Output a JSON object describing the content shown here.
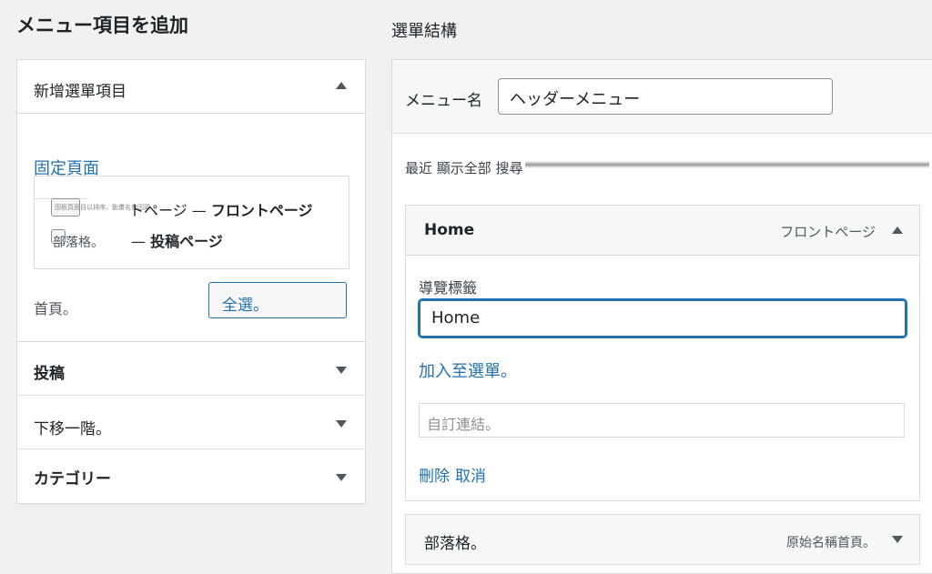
{
  "headings": {
    "left": "メニュー項目を追加",
    "right": "選單結構"
  },
  "left_panel": {
    "sections": [
      {
        "label": "新增選單項目",
        "expanded": true
      },
      {
        "label": "投稿",
        "expanded": false
      },
      {
        "label": "下移一階。",
        "expanded": false
      },
      {
        "label": "カテゴリー",
        "expanded": false
      }
    ],
    "tab_title": "固定頁面",
    "list_items": [
      {
        "prefix_small": "固板頁面目以排序，動畫名會因頭",
        "text_plain": "トページ — ",
        "text_bold": "フロントページ"
      },
      {
        "prefix": "部落格。",
        "text_plain": "— ",
        "text_bold": "投稿ページ"
      }
    ],
    "footer_left": "首頁。",
    "select_all": "全選。"
  },
  "menu": {
    "name_label": "メニュー名",
    "name_value": "ヘッダーメニュー",
    "recent_label": "最近 顯示全部 搜尋",
    "items": [
      {
        "title": "Home",
        "type": "フロントページ",
        "expanded": true,
        "nav_label_caption": "導覽標籤",
        "nav_label_value": "Home",
        "add_link": "加入至選單。",
        "custom_link_placeholder": "自訂連結。",
        "remove": "刪除",
        "cancel": "取消"
      },
      {
        "title": "部落格。",
        "type": "原始名稱首頁。",
        "expanded": false
      }
    ]
  },
  "colors": {
    "accent": "#2271b1",
    "text": "#1d2327",
    "border": "#dcdcde",
    "background": "#f1f1f1"
  }
}
